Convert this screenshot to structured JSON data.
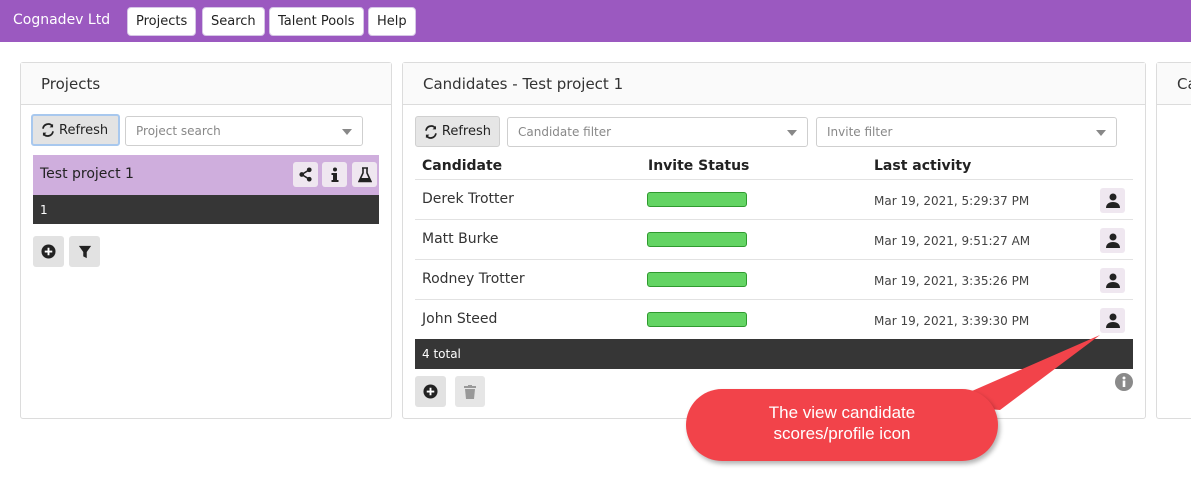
{
  "header": {
    "brand": "Cognadev Ltd",
    "nav": [
      "Projects",
      "Search",
      "Talent Pools",
      "Help"
    ],
    "color": "#9b59c0"
  },
  "projects_panel": {
    "title": "Projects",
    "refresh_label": "Refresh",
    "search_placeholder": "Project search",
    "selected_project": "Test project 1",
    "project_count": "1",
    "row_color": "#cfaedd"
  },
  "candidates_panel": {
    "title": "Candidates - Test project 1",
    "refresh_label": "Refresh",
    "candidate_filter_placeholder": "Candidate filter",
    "invite_filter_placeholder": "Invite filter",
    "columns": [
      "Candidate",
      "Invite Status",
      "Last activity"
    ],
    "rows": [
      {
        "name": "Derek Trotter",
        "status": "complete",
        "last_activity": "Mar 19, 2021, 5:29:37 PM"
      },
      {
        "name": "Matt Burke",
        "status": "complete",
        "last_activity": "Mar 19, 2021, 9:51:27 AM"
      },
      {
        "name": "Rodney Trotter",
        "status": "complete",
        "last_activity": "Mar 19, 2021, 3:35:26 PM"
      },
      {
        "name": "John Steed",
        "status": "complete",
        "last_activity": "Mar 19, 2021, 3:39:30 PM"
      }
    ],
    "total": "4 total",
    "status_color": "#63d463"
  },
  "third_panel": {
    "title_fragment": "Ca"
  },
  "annotation": {
    "text_line1": "The view candidate",
    "text_line2": "scores/profile icon",
    "color": "#f2434a"
  },
  "icons": [
    "refresh-icon",
    "share-icon",
    "info-icon",
    "flask-icon",
    "plus-circle-icon",
    "filter-icon",
    "trash-icon",
    "user-icon",
    "info-circle-icon"
  ]
}
